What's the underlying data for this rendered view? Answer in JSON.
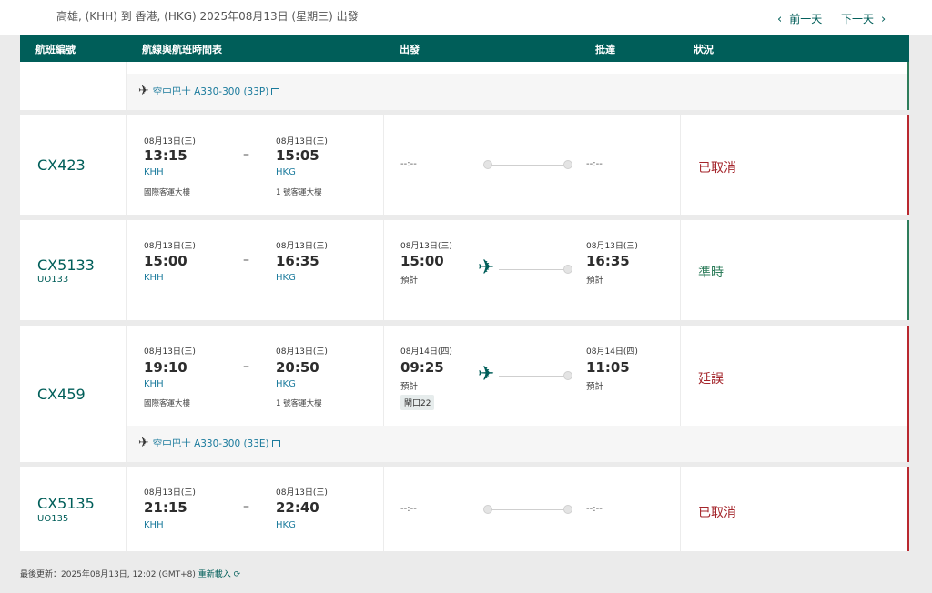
{
  "header": {
    "route": "高雄, (KHH) 到 香港, (HKG) 2025年08月13日 (星期三) 出發",
    "prev_day": "前一天",
    "next_day": "下一天"
  },
  "columns": {
    "flight_no": "航班編號",
    "route_schedule": "航線與航班時間表",
    "departure": "出發",
    "arrival": "抵達",
    "status": "狀況"
  },
  "flights": [
    {
      "aircraft": "空中巴士 A330-300 (33P)"
    },
    {
      "flight_no": "CX423",
      "sched_dep_date": "08月13日(三)",
      "sched_dep_time": "13:15",
      "dep_airport": "KHH",
      "dep_terminal": "國際客運大樓",
      "sched_arr_date": "08月13日(三)",
      "sched_arr_time": "15:05",
      "arr_airport": "HKG",
      "arr_terminal": "1 號客運大樓",
      "dep_actual": "--:--",
      "arr_actual": "--:--",
      "status": "已取消"
    },
    {
      "flight_no": "CX5133",
      "codeshare": "UO133",
      "sched_dep_date": "08月13日(三)",
      "sched_dep_time": "15:00",
      "dep_airport": "KHH",
      "sched_arr_date": "08月13日(三)",
      "sched_arr_time": "16:35",
      "arr_airport": "HKG",
      "dep_est_date": "08月13日(三)",
      "dep_est_time": "15:00",
      "dep_est_label": "預計",
      "arr_est_date": "08月13日(三)",
      "arr_est_time": "16:35",
      "arr_est_label": "預計",
      "status": "準時"
    },
    {
      "flight_no": "CX459",
      "sched_dep_date": "08月13日(三)",
      "sched_dep_time": "19:10",
      "dep_airport": "KHH",
      "dep_terminal": "國際客運大樓",
      "sched_arr_date": "08月13日(三)",
      "sched_arr_time": "20:50",
      "arr_airport": "HKG",
      "arr_terminal": "1 號客運大樓",
      "dep_est_date": "08月14日(四)",
      "dep_est_time": "09:25",
      "dep_est_label": "預計",
      "gate": "閘口22",
      "arr_est_date": "08月14日(四)",
      "arr_est_time": "11:05",
      "arr_est_label": "預計",
      "status": "延誤",
      "aircraft": "空中巴士 A330-300 (33E)"
    },
    {
      "flight_no": "CX5135",
      "codeshare": "UO135",
      "sched_dep_date": "08月13日(三)",
      "sched_dep_time": "21:15",
      "dep_airport": "KHH",
      "sched_arr_date": "08月13日(三)",
      "sched_arr_time": "22:40",
      "arr_airport": "HKG",
      "dep_actual": "--:--",
      "arr_actual": "--:--",
      "status": "已取消"
    }
  ],
  "footer": {
    "last_updated": "最後更新：2025年08月13日, 12:02 (GMT+8)",
    "reload": "重新載入"
  }
}
